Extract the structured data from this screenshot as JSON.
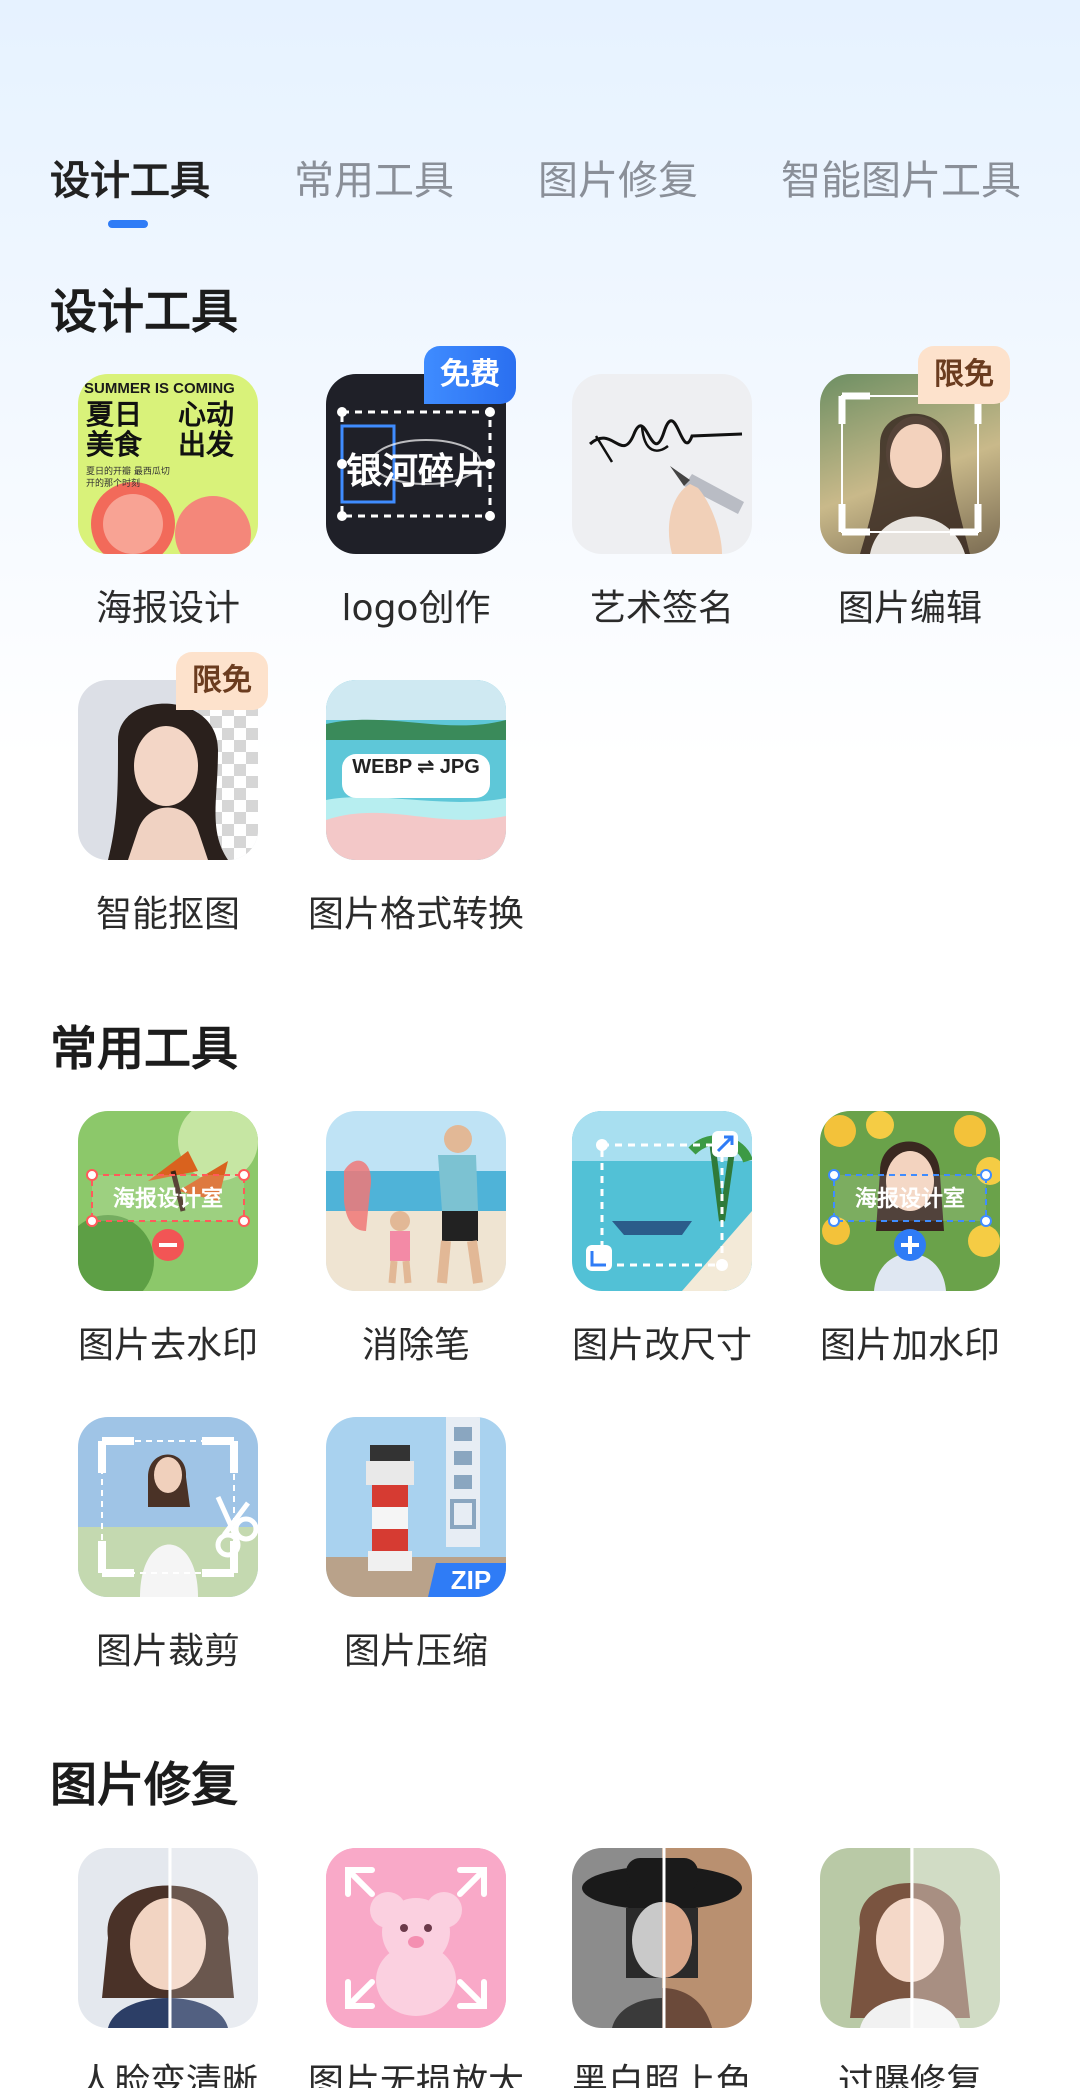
{
  "tabs": [
    {
      "label": "设计工具",
      "active": true
    },
    {
      "label": "常用工具",
      "active": false
    },
    {
      "label": "图片修复",
      "active": false
    },
    {
      "label": "智能图片工具",
      "active": false
    }
  ],
  "accent_color": "#2f7cf6",
  "sections": {
    "design": {
      "title": "设计工具",
      "tools": [
        {
          "label": "海报设计",
          "icon": "poster-icon",
          "poster_text": {
            "line1": "SUMMER IS COMING",
            "left": "夏日\n美食",
            "right": "心动\n出发",
            "caption": "夏日的开瓣 最西瓜切开的那个时刻"
          }
        },
        {
          "label": "logo创作",
          "icon": "logo-icon",
          "badge": "免费",
          "logo_text": "银河碎片"
        },
        {
          "label": "艺术签名",
          "icon": "signature-icon"
        },
        {
          "label": "图片编辑",
          "icon": "photo-edit-icon",
          "badge": "限免"
        },
        {
          "label": "智能抠图",
          "icon": "cutout-icon",
          "badge": "限免"
        },
        {
          "label": "图片格式转换",
          "icon": "format-convert-icon",
          "format_text": "WEBP ⇌ JPG"
        }
      ]
    },
    "common": {
      "title": "常用工具",
      "tools": [
        {
          "label": "图片去水印",
          "icon": "remove-watermark-icon",
          "watermark_text": "海报设计室"
        },
        {
          "label": "消除笔",
          "icon": "eraser-pen-icon"
        },
        {
          "label": "图片改尺寸",
          "icon": "resize-icon"
        },
        {
          "label": "图片加水印",
          "icon": "add-watermark-icon",
          "watermark_text": "海报设计室"
        },
        {
          "label": "图片裁剪",
          "icon": "crop-icon"
        },
        {
          "label": "图片压缩",
          "icon": "compress-icon",
          "zip_text": "ZIP"
        }
      ]
    },
    "repair": {
      "title": "图片修复",
      "tools": [
        {
          "label": "人脸变清晰",
          "icon": "face-enhance-icon"
        },
        {
          "label": "图片无损放大",
          "icon": "upscale-icon"
        },
        {
          "label": "黑白照上色",
          "icon": "colorize-icon"
        },
        {
          "label": "过曝修复",
          "icon": "overexposure-fix-icon"
        }
      ]
    }
  }
}
